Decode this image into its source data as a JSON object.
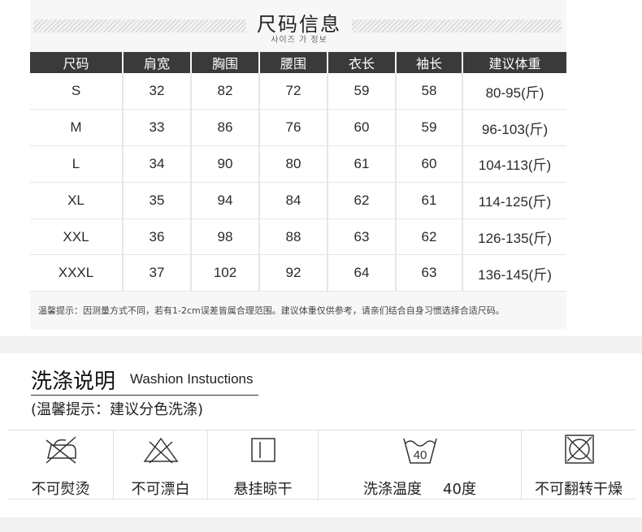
{
  "size_info": {
    "title": "尺码信息",
    "subtitle": "사이즈 가 정보",
    "headers": [
      "尺码",
      "肩宽",
      "胸围",
      "腰围",
      "衣长",
      "袖长",
      "建议体重"
    ],
    "rows": [
      [
        "S",
        "32",
        "82",
        "72",
        "59",
        "58",
        "80-95(斤)"
      ],
      [
        "M",
        "33",
        "86",
        "76",
        "60",
        "59",
        "96-103(斤)"
      ],
      [
        "L",
        "34",
        "90",
        "80",
        "61",
        "60",
        "104-113(斤)"
      ],
      [
        "XL",
        "35",
        "94",
        "84",
        "62",
        "61",
        "114-125(斤)"
      ],
      [
        "XXL",
        "36",
        "98",
        "88",
        "63",
        "62",
        "126-135(斤)"
      ],
      [
        "XXXL",
        "37",
        "102",
        "92",
        "64",
        "63",
        "136-145(斤)"
      ]
    ],
    "note": "温馨提示：因测量方式不同，若有1-2cm误差皆属合理范围。建议体重仅供参考，请亲们结合自身习惯选择合适尺码。"
  },
  "wash_info": {
    "title": "洗涤说明",
    "title_en": "Washion Instuctions",
    "tip": "(温馨提示：建议分色洗涤)",
    "items": [
      {
        "icon": "no-iron-icon",
        "label": "不可熨烫"
      },
      {
        "icon": "no-bleach-icon",
        "label": "不可漂白"
      },
      {
        "icon": "hang-dry-icon",
        "label": "悬挂晾干"
      },
      {
        "icon": "wash-40-icon",
        "label": "洗涤温度",
        "value": "40度",
        "icon_text": "40"
      },
      {
        "icon": "no-tumble-dry-icon",
        "label": "不可翻转干燥"
      }
    ]
  }
}
